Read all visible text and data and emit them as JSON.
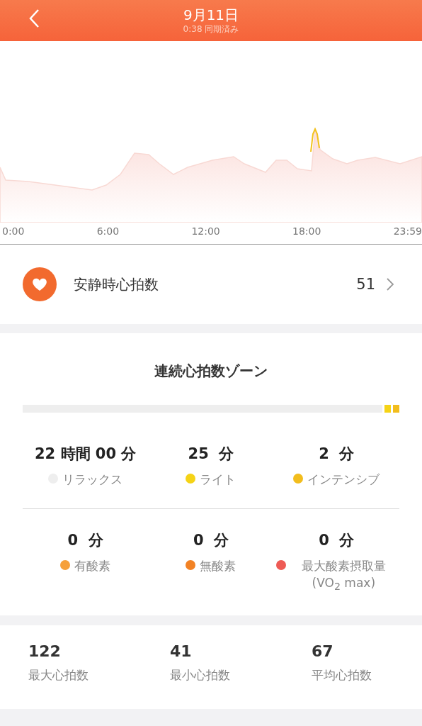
{
  "header": {
    "title": "9月11日",
    "subtitle": "0:38 同期済み"
  },
  "chart": {
    "x_labels": [
      "0:00",
      "6:00",
      "12:00",
      "18:00",
      "23:59"
    ]
  },
  "resting": {
    "label": "安静時心拍数",
    "value": "51"
  },
  "zones": {
    "title": "連続心拍数ゾーン",
    "bar": [
      {
        "color": "#eeeeee"
      },
      {
        "color": "#f5d316"
      },
      {
        "color": "#f2bd1d"
      }
    ],
    "items": [
      {
        "value": "22 時間 00 分",
        "label": "リラックス",
        "color": "#eeeeee"
      },
      {
        "value": "25  分",
        "label": "ライト",
        "color": "#f5d316"
      },
      {
        "value": "2  分",
        "label": "インテンシブ",
        "color": "#f2bd1d"
      },
      {
        "value": "0  分",
        "label": "有酸素",
        "color": "#f6a03a"
      },
      {
        "value": "0  分",
        "label": "無酸素",
        "color": "#f28224"
      },
      {
        "value": "0  分",
        "label": "最大酸素摂取量 (VO$_{2}$ max)",
        "color": "#ee5b55"
      }
    ]
  },
  "stats": [
    {
      "value": "122",
      "label": "最大心拍数"
    },
    {
      "value": "41",
      "label": "最小心拍数"
    },
    {
      "value": "67",
      "label": "平均心拍数"
    }
  ]
}
